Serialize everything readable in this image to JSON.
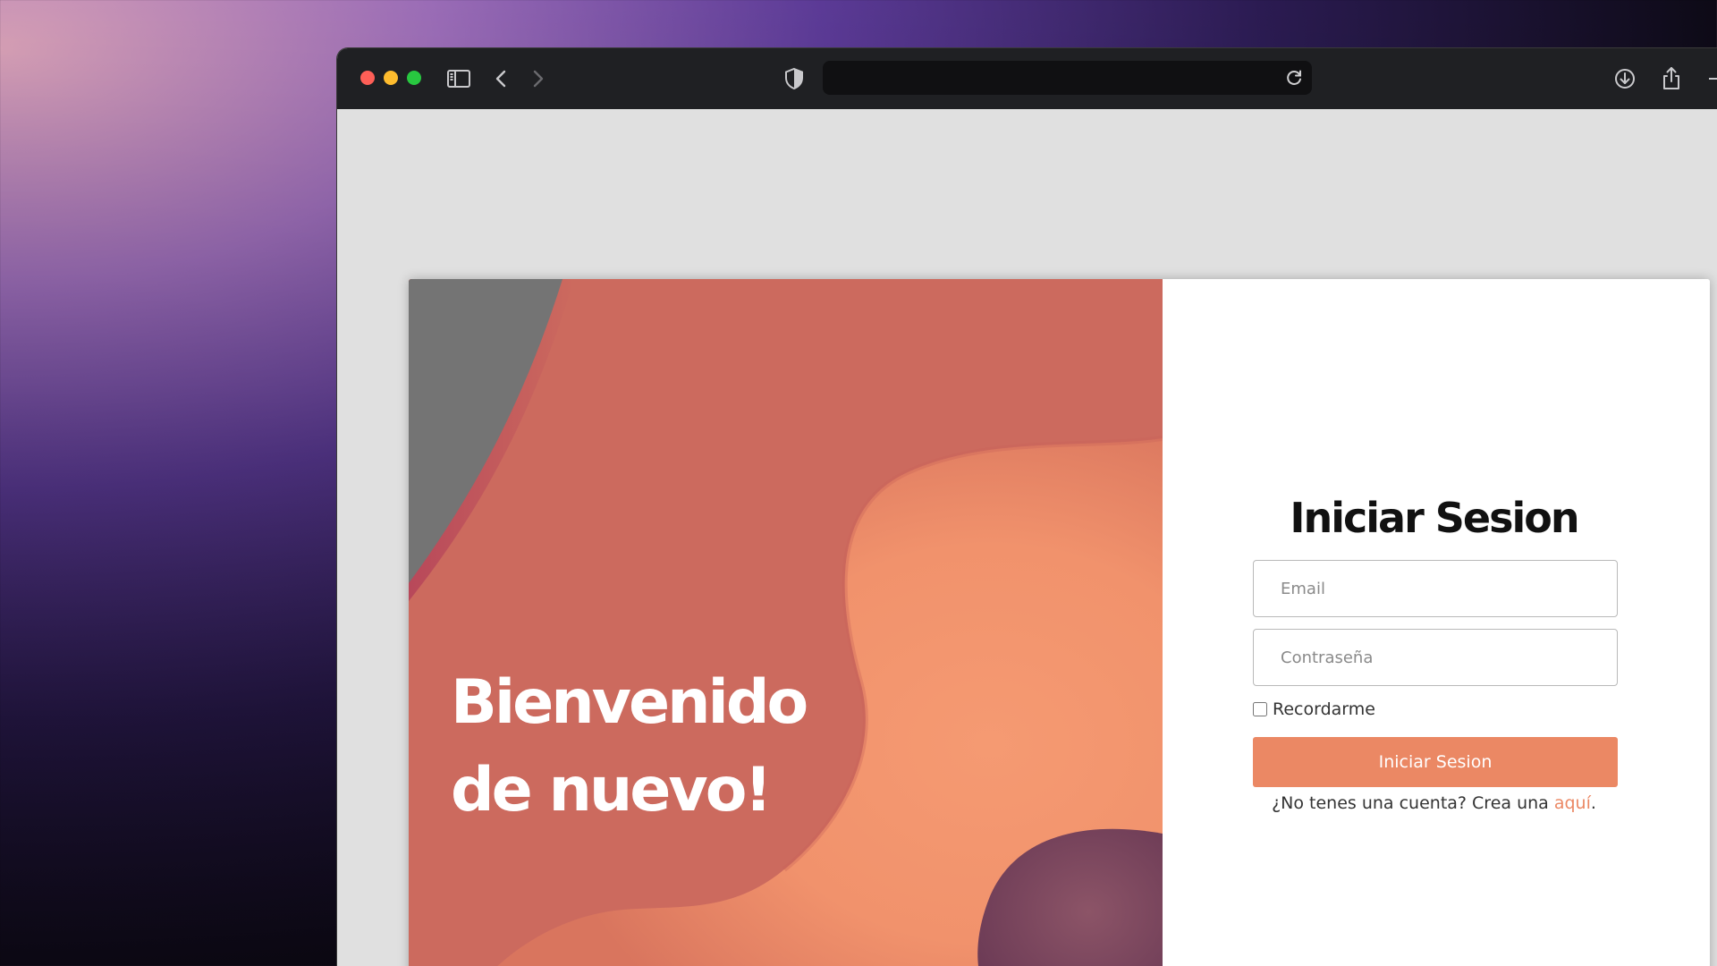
{
  "browser": {
    "address_value": ""
  },
  "hero": {
    "title_line1": "Bienvenido",
    "title_line2": "de nuevo!"
  },
  "login": {
    "title": "Iniciar Sesion",
    "email_placeholder": "Email",
    "password_placeholder": "Contraseña",
    "remember_label": "Recordarme",
    "submit_label": "Iniciar Sesion",
    "signup_prefix": "¿No tenes una cuenta? Crea una ",
    "signup_link": "aquí",
    "signup_suffix": "."
  },
  "colors": {
    "accent": "#eb8864",
    "hero_base": "#cc6a5e",
    "toolbar": "#1f2023"
  },
  "icons": {
    "sidebar": "sidebar-icon",
    "back": "chevron-left-icon",
    "forward": "chevron-right-icon",
    "privacy": "shield-icon",
    "reload": "reload-icon",
    "download": "download-icon",
    "share": "share-icon"
  }
}
